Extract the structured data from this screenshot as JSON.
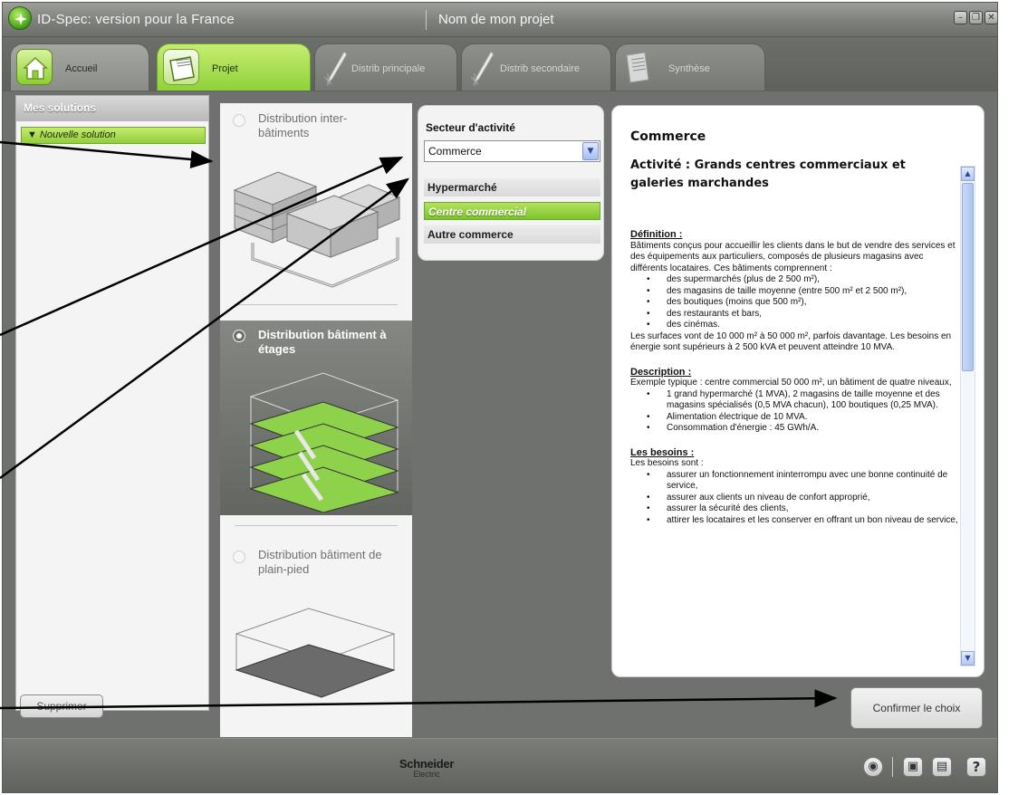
{
  "window": {
    "app_title": "ID-Spec: version pour la France",
    "project_name": "Nom de mon projet",
    "controls": [
      "minimize",
      "restore",
      "close"
    ]
  },
  "tabs": [
    {
      "label": "Accueil",
      "icon": "home-icon"
    },
    {
      "label": "Projet",
      "icon": "folder-icon",
      "selected": true
    },
    {
      "label": "Distrib principale",
      "icon": "pen-icon"
    },
    {
      "label": "Distrib secondaire",
      "icon": "pen-icon"
    },
    {
      "label": "Synthèse",
      "icon": "notepad-icon"
    }
  ],
  "sidebar": {
    "header": "Mes solutions",
    "item": "▼ Nouvelle solution",
    "delete_label": "Supprimer"
  },
  "distribution": [
    {
      "title": "Distribution inter-bâtiments",
      "selected": false
    },
    {
      "title": "Distribution bâtiment à étages",
      "selected": true
    },
    {
      "title": "Distribution bâtiment de plain-pied",
      "selected": false
    }
  ],
  "secteur": {
    "title": "Secteur d'activité",
    "selected_value": "Commerce",
    "items": [
      "Hypermarché",
      "Centre commercial",
      "Autre commerce"
    ],
    "selected_item": "Centre commercial"
  },
  "content": {
    "heading": "Commerce",
    "activity": "Activité : Grands centres commerciaux et galeries marchandes",
    "definition_head": "Définition :",
    "definition_text": "Bâtiments conçus pour accueillir les clients dans le but de vendre des services et des équipements aux particuliers, composés de plusieurs magasins avec différents locataires. Ces bâtiments comprennent :",
    "definition_list": [
      "des supermarchés (plus de 2 500 m²),",
      "des magasins de taille moyenne (entre 500 m² et 2 500 m²),",
      "des boutiques (moins que 500 m²),",
      "des restaurants et bars,",
      "des cinémas."
    ],
    "surfaces_text": "Les surfaces vont de 10 000 m² à 50 000 m², parfois davantage. Les besoins en énergie sont supérieurs à 2 500 kVA et peuvent atteindre 10 MVA.",
    "description_head": "Description :",
    "description_text": "Exemple typique : centre commercial 50 000 m², un bâtiment de quatre niveaux,",
    "description_list": [
      "1 grand hypermarché (1 MVA), 2 magasins de taille moyenne et des magasins spécialisés (0,5 MVA chacun), 100 boutiques (0,25 MVA).",
      "Alimentation électrique de 10 MVA.",
      "Consommation d'énergie : 45 GWh/A."
    ],
    "besoins_head": "Les besoins :",
    "besoins_text": "Les besoins sont :",
    "besoins_list": [
      "assurer un fonctionnement ininterrompu avec une bonne continuité de service,",
      "assurer aux clients un niveau de confort approprié,",
      "assurer la sécurité des clients,",
      "attirer les locataires et les conserver en offrant un bon niveau de service,"
    ],
    "scroll_position": 0.0
  },
  "actions": {
    "confirm_label": "Confirmer le choix"
  },
  "footer": {
    "brand_name": "Schneider",
    "brand_sub": "Electric",
    "icons": [
      "eye-icon",
      "save-icon",
      "print-icon",
      "help-icon"
    ],
    "help_glyph": "?"
  },
  "colors": {
    "accent_green": "#8fd23a",
    "selection_dark": "#6c6e6a",
    "frame_gray": "#6f716e"
  }
}
